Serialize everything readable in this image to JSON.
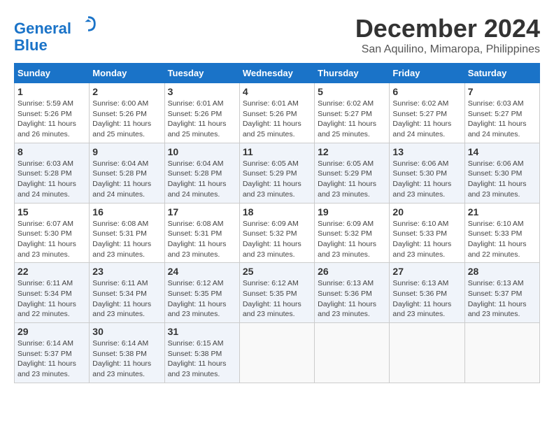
{
  "header": {
    "logo_line1": "General",
    "logo_line2": "Blue",
    "month_title": "December 2024",
    "location": "San Aquilino, Mimaropa, Philippines"
  },
  "weekdays": [
    "Sunday",
    "Monday",
    "Tuesday",
    "Wednesday",
    "Thursday",
    "Friday",
    "Saturday"
  ],
  "weeks": [
    [
      {
        "day": "1",
        "sunrise": "Sunrise: 5:59 AM",
        "sunset": "Sunset: 5:26 PM",
        "daylight": "Daylight: 11 hours and 26 minutes."
      },
      {
        "day": "2",
        "sunrise": "Sunrise: 6:00 AM",
        "sunset": "Sunset: 5:26 PM",
        "daylight": "Daylight: 11 hours and 25 minutes."
      },
      {
        "day": "3",
        "sunrise": "Sunrise: 6:01 AM",
        "sunset": "Sunset: 5:26 PM",
        "daylight": "Daylight: 11 hours and 25 minutes."
      },
      {
        "day": "4",
        "sunrise": "Sunrise: 6:01 AM",
        "sunset": "Sunset: 5:26 PM",
        "daylight": "Daylight: 11 hours and 25 minutes."
      },
      {
        "day": "5",
        "sunrise": "Sunrise: 6:02 AM",
        "sunset": "Sunset: 5:27 PM",
        "daylight": "Daylight: 11 hours and 25 minutes."
      },
      {
        "day": "6",
        "sunrise": "Sunrise: 6:02 AM",
        "sunset": "Sunset: 5:27 PM",
        "daylight": "Daylight: 11 hours and 24 minutes."
      },
      {
        "day": "7",
        "sunrise": "Sunrise: 6:03 AM",
        "sunset": "Sunset: 5:27 PM",
        "daylight": "Daylight: 11 hours and 24 minutes."
      }
    ],
    [
      {
        "day": "8",
        "sunrise": "Sunrise: 6:03 AM",
        "sunset": "Sunset: 5:28 PM",
        "daylight": "Daylight: 11 hours and 24 minutes."
      },
      {
        "day": "9",
        "sunrise": "Sunrise: 6:04 AM",
        "sunset": "Sunset: 5:28 PM",
        "daylight": "Daylight: 11 hours and 24 minutes."
      },
      {
        "day": "10",
        "sunrise": "Sunrise: 6:04 AM",
        "sunset": "Sunset: 5:28 PM",
        "daylight": "Daylight: 11 hours and 24 minutes."
      },
      {
        "day": "11",
        "sunrise": "Sunrise: 6:05 AM",
        "sunset": "Sunset: 5:29 PM",
        "daylight": "Daylight: 11 hours and 23 minutes."
      },
      {
        "day": "12",
        "sunrise": "Sunrise: 6:05 AM",
        "sunset": "Sunset: 5:29 PM",
        "daylight": "Daylight: 11 hours and 23 minutes."
      },
      {
        "day": "13",
        "sunrise": "Sunrise: 6:06 AM",
        "sunset": "Sunset: 5:30 PM",
        "daylight": "Daylight: 11 hours and 23 minutes."
      },
      {
        "day": "14",
        "sunrise": "Sunrise: 6:06 AM",
        "sunset": "Sunset: 5:30 PM",
        "daylight": "Daylight: 11 hours and 23 minutes."
      }
    ],
    [
      {
        "day": "15",
        "sunrise": "Sunrise: 6:07 AM",
        "sunset": "Sunset: 5:30 PM",
        "daylight": "Daylight: 11 hours and 23 minutes."
      },
      {
        "day": "16",
        "sunrise": "Sunrise: 6:08 AM",
        "sunset": "Sunset: 5:31 PM",
        "daylight": "Daylight: 11 hours and 23 minutes."
      },
      {
        "day": "17",
        "sunrise": "Sunrise: 6:08 AM",
        "sunset": "Sunset: 5:31 PM",
        "daylight": "Daylight: 11 hours and 23 minutes."
      },
      {
        "day": "18",
        "sunrise": "Sunrise: 6:09 AM",
        "sunset": "Sunset: 5:32 PM",
        "daylight": "Daylight: 11 hours and 23 minutes."
      },
      {
        "day": "19",
        "sunrise": "Sunrise: 6:09 AM",
        "sunset": "Sunset: 5:32 PM",
        "daylight": "Daylight: 11 hours and 23 minutes."
      },
      {
        "day": "20",
        "sunrise": "Sunrise: 6:10 AM",
        "sunset": "Sunset: 5:33 PM",
        "daylight": "Daylight: 11 hours and 23 minutes."
      },
      {
        "day": "21",
        "sunrise": "Sunrise: 6:10 AM",
        "sunset": "Sunset: 5:33 PM",
        "daylight": "Daylight: 11 hours and 22 minutes."
      }
    ],
    [
      {
        "day": "22",
        "sunrise": "Sunrise: 6:11 AM",
        "sunset": "Sunset: 5:34 PM",
        "daylight": "Daylight: 11 hours and 22 minutes."
      },
      {
        "day": "23",
        "sunrise": "Sunrise: 6:11 AM",
        "sunset": "Sunset: 5:34 PM",
        "daylight": "Daylight: 11 hours and 23 minutes."
      },
      {
        "day": "24",
        "sunrise": "Sunrise: 6:12 AM",
        "sunset": "Sunset: 5:35 PM",
        "daylight": "Daylight: 11 hours and 23 minutes."
      },
      {
        "day": "25",
        "sunrise": "Sunrise: 6:12 AM",
        "sunset": "Sunset: 5:35 PM",
        "daylight": "Daylight: 11 hours and 23 minutes."
      },
      {
        "day": "26",
        "sunrise": "Sunrise: 6:13 AM",
        "sunset": "Sunset: 5:36 PM",
        "daylight": "Daylight: 11 hours and 23 minutes."
      },
      {
        "day": "27",
        "sunrise": "Sunrise: 6:13 AM",
        "sunset": "Sunset: 5:36 PM",
        "daylight": "Daylight: 11 hours and 23 minutes."
      },
      {
        "day": "28",
        "sunrise": "Sunrise: 6:13 AM",
        "sunset": "Sunset: 5:37 PM",
        "daylight": "Daylight: 11 hours and 23 minutes."
      }
    ],
    [
      {
        "day": "29",
        "sunrise": "Sunrise: 6:14 AM",
        "sunset": "Sunset: 5:37 PM",
        "daylight": "Daylight: 11 hours and 23 minutes."
      },
      {
        "day": "30",
        "sunrise": "Sunrise: 6:14 AM",
        "sunset": "Sunset: 5:38 PM",
        "daylight": "Daylight: 11 hours and 23 minutes."
      },
      {
        "day": "31",
        "sunrise": "Sunrise: 6:15 AM",
        "sunset": "Sunset: 5:38 PM",
        "daylight": "Daylight: 11 hours and 23 minutes."
      },
      null,
      null,
      null,
      null
    ]
  ]
}
